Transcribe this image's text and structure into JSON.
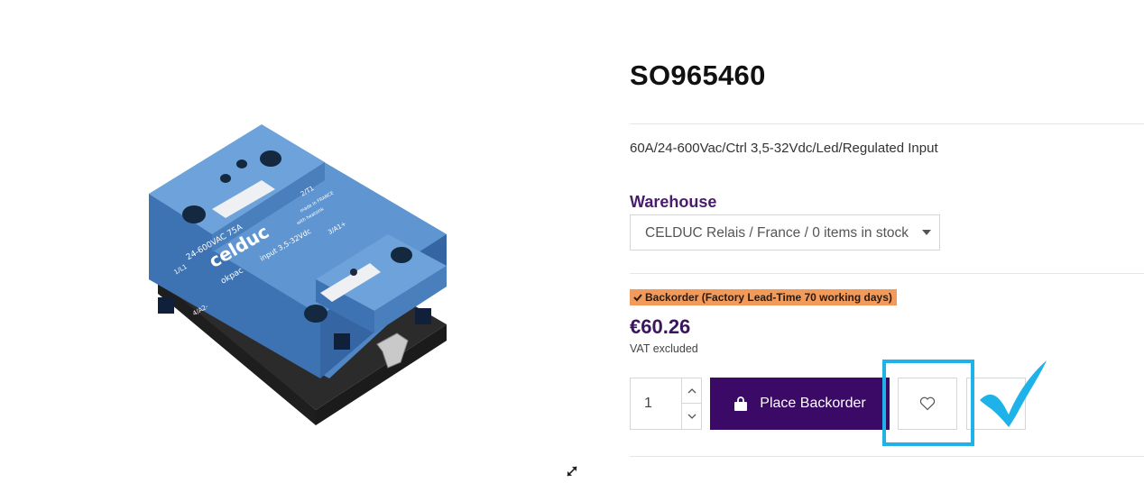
{
  "product": {
    "title": "SO965460",
    "description": "60A/24-600Vac/Ctrl 3,5-32Vdc/Led/Regulated Input",
    "image_label": {
      "brand": "celduc",
      "rating": "24-600VAC 75A",
      "input": "input 3,5-32Vdc",
      "terminal_l1": "1/L1",
      "terminal_t1": "2/T1",
      "terminal_a2": "4/A2-",
      "terminal_a1": "3/A1+",
      "made_in": "made in FRANCE",
      "heatsink": "with heatsink",
      "series": "okpac"
    }
  },
  "warehouse": {
    "label": "Warehouse",
    "selected": "CELDUC Relais / France / 0 items in stock"
  },
  "availability": {
    "badge": "Backorder (Factory Lead-Time 70 working days)",
    "badge_color": "#f29a5a"
  },
  "pricing": {
    "price": "€60.26",
    "vat_note": "VAT excluded"
  },
  "purchase": {
    "quantity": "1",
    "button_label": "Place Backorder",
    "button_color": "#3a0a66"
  },
  "icons": {
    "expand": "expand-icon",
    "wishlist": "heart-icon",
    "cart": "shopping-bag-icon",
    "badge": "check-icon"
  },
  "annotation": {
    "highlight_color": "#1fb2e8"
  }
}
